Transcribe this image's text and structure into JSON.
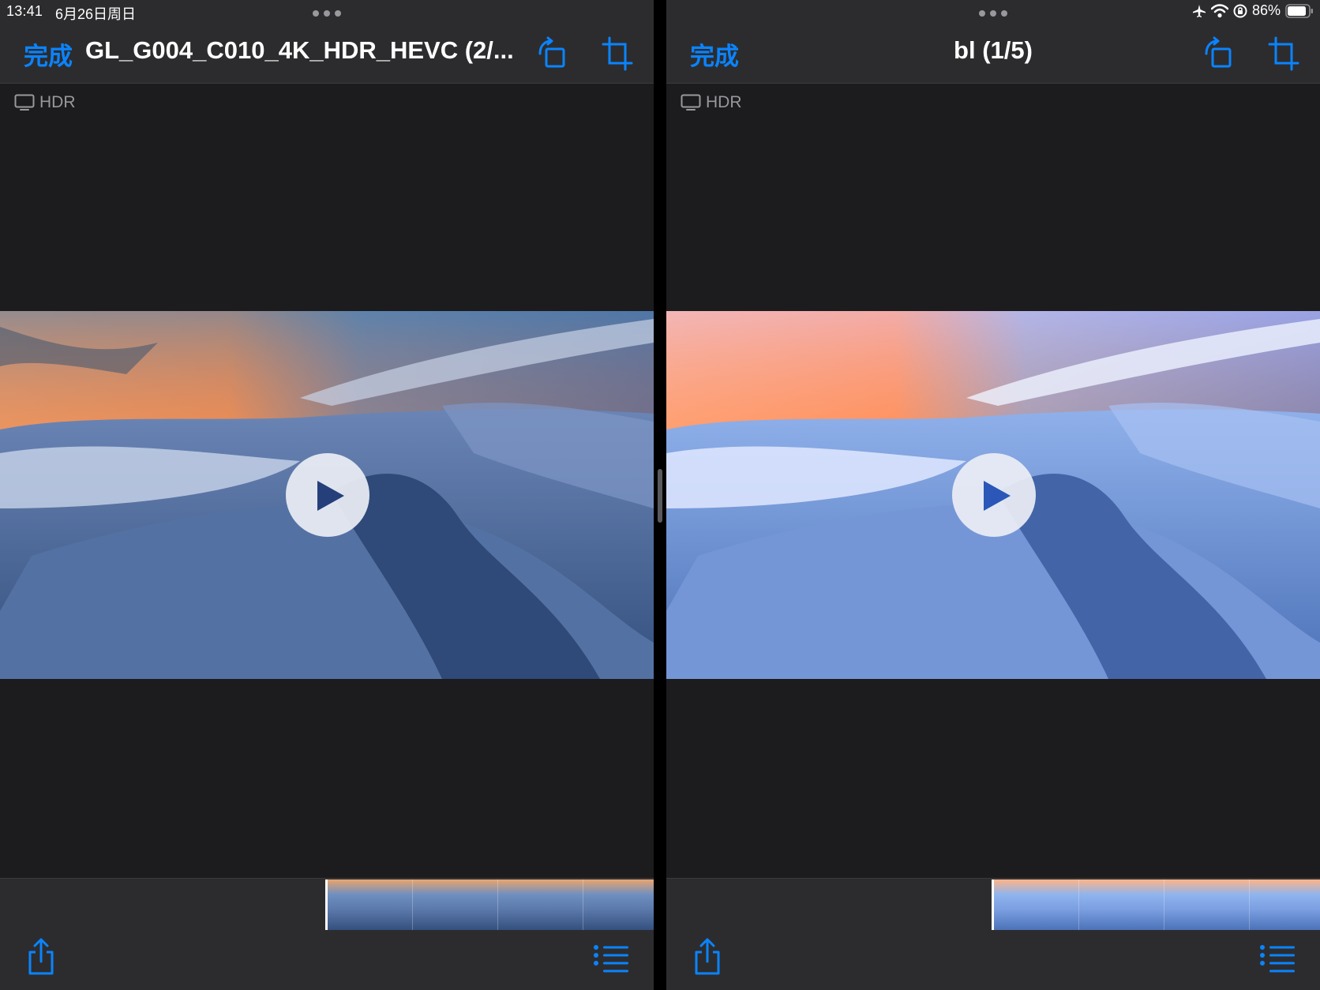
{
  "status_bar": {
    "time": "13:41",
    "date": "6月26日周日",
    "battery": "86%"
  },
  "left_pane": {
    "done_label": "完成",
    "title": "GL_G004_C010_4K_HDR_HEVC (2/...",
    "hdr_label": "HDR"
  },
  "right_pane": {
    "done_label": "完成",
    "title": "bl (1/5)",
    "hdr_label": "HDR"
  },
  "colors": {
    "accent": "#0a84ff",
    "background": "#1c1c1e",
    "bar": "#2c2c2e"
  },
  "icons": [
    "rotate-icon",
    "crop-icon",
    "monitor-icon",
    "play-icon",
    "share-icon",
    "list-icon",
    "airplane-icon",
    "wifi-icon",
    "orientation-lock-icon",
    "battery-icon"
  ]
}
